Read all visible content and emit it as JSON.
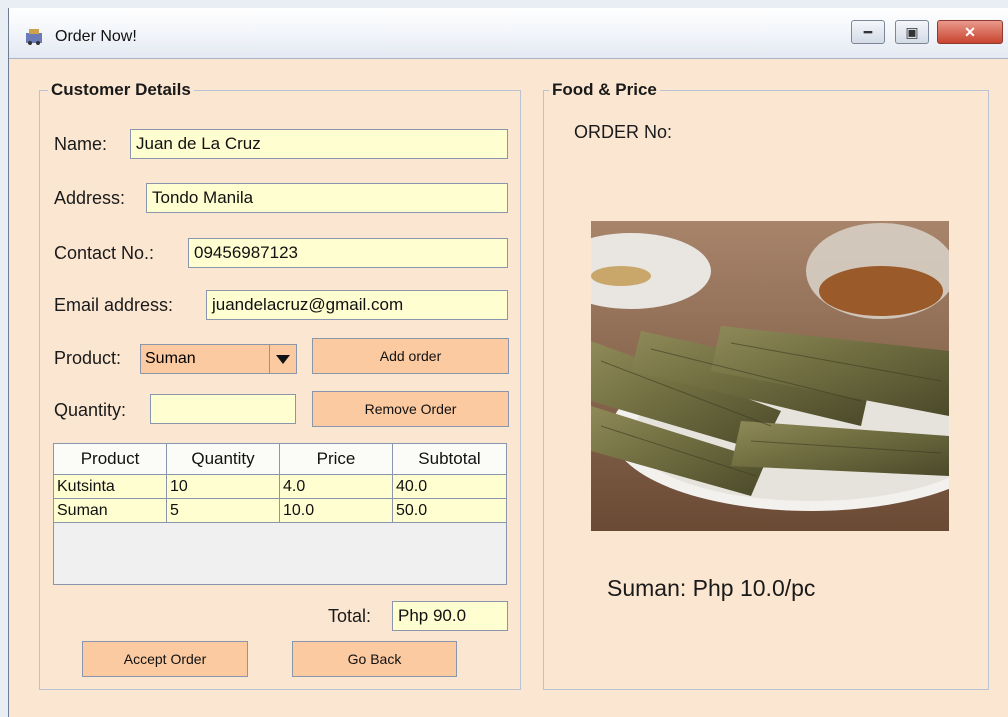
{
  "window": {
    "title": "Order Now!",
    "icon": "app-icon"
  },
  "customer_details": {
    "legend": "Customer Details",
    "name_label": "Name:",
    "name_value": "Juan de La Cruz",
    "address_label": "Address:",
    "address_value": "Tondo Manila",
    "contact_label": "Contact No.:",
    "contact_value": "09456987123",
    "email_label": "Email address:",
    "email_value": "juandelacruz@gmail.com",
    "product_label": "Product:",
    "product_selected": "Suman",
    "quantity_label": "Quantity:",
    "quantity_value": "",
    "add_order_label": "Add order",
    "remove_order_label": "Remove Order",
    "table": {
      "headers": [
        "Product",
        "Quantity",
        "Price",
        "Subtotal"
      ],
      "rows": [
        [
          "Kutsinta",
          "10",
          "4.0",
          "40.0"
        ],
        [
          "Suman",
          "5",
          "10.0",
          "50.0"
        ]
      ]
    },
    "total_label": "Total:",
    "total_value": "Php 90.0",
    "accept_label": "Accept Order",
    "back_label": "Go Back"
  },
  "food_price": {
    "legend": "Food & Price",
    "order_no_label": "ORDER No:",
    "price_caption": "Suman: Php 10.0/pc"
  },
  "colors": {
    "panel_bg": "#fbe6d1",
    "field_bg": "#fefed0",
    "button_bg": "#fbcaa0"
  }
}
